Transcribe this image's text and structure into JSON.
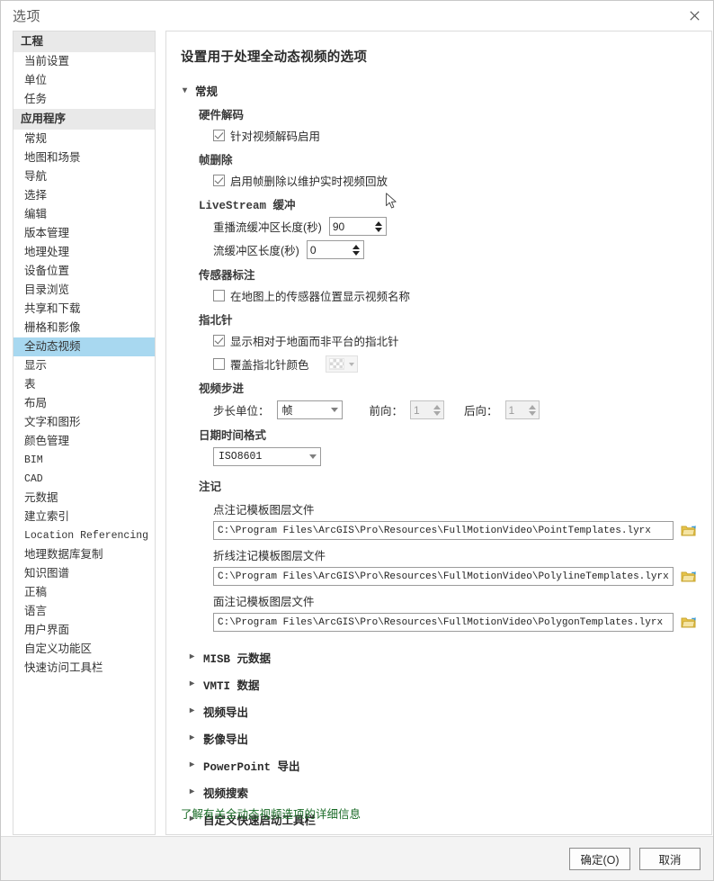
{
  "window": {
    "title": "选项",
    "close_icon": "close-icon"
  },
  "sidebar": {
    "groups": [
      {
        "header": "工程",
        "items": [
          {
            "label": "当前设置",
            "selected": false,
            "mono": false
          },
          {
            "label": "单位",
            "selected": false,
            "mono": false
          },
          {
            "label": "任务",
            "selected": false,
            "mono": false
          }
        ]
      },
      {
        "header": "应用程序",
        "items": [
          {
            "label": "常规",
            "selected": false,
            "mono": false
          },
          {
            "label": "地图和场景",
            "selected": false,
            "mono": false
          },
          {
            "label": "导航",
            "selected": false,
            "mono": false
          },
          {
            "label": "选择",
            "selected": false,
            "mono": false
          },
          {
            "label": "编辑",
            "selected": false,
            "mono": false
          },
          {
            "label": "版本管理",
            "selected": false,
            "mono": false
          },
          {
            "label": "地理处理",
            "selected": false,
            "mono": false
          },
          {
            "label": "设备位置",
            "selected": false,
            "mono": false
          },
          {
            "label": "目录浏览",
            "selected": false,
            "mono": false
          },
          {
            "label": "共享和下载",
            "selected": false,
            "mono": false
          },
          {
            "label": "栅格和影像",
            "selected": false,
            "mono": false
          },
          {
            "label": "全动态视频",
            "selected": true,
            "mono": false
          },
          {
            "label": "显示",
            "selected": false,
            "mono": false
          },
          {
            "label": "表",
            "selected": false,
            "mono": false
          },
          {
            "label": "布局",
            "selected": false,
            "mono": false
          },
          {
            "label": "文字和图形",
            "selected": false,
            "mono": false
          },
          {
            "label": "颜色管理",
            "selected": false,
            "mono": false
          },
          {
            "label": "BIM",
            "selected": false,
            "mono": true
          },
          {
            "label": "CAD",
            "selected": false,
            "mono": true
          },
          {
            "label": "元数据",
            "selected": false,
            "mono": false
          },
          {
            "label": "建立索引",
            "selected": false,
            "mono": false
          },
          {
            "label": "Location Referencing",
            "selected": false,
            "mono": true
          },
          {
            "label": "地理数据库复制",
            "selected": false,
            "mono": false
          },
          {
            "label": "知识图谱",
            "selected": false,
            "mono": false
          },
          {
            "label": "正稿",
            "selected": false,
            "mono": false
          },
          {
            "label": "语言",
            "selected": false,
            "mono": false
          },
          {
            "label": "用户界面",
            "selected": false,
            "mono": false
          },
          {
            "label": "自定义功能区",
            "selected": false,
            "mono": false
          },
          {
            "label": "快速访问工具栏",
            "selected": false,
            "mono": false
          }
        ]
      }
    ]
  },
  "main": {
    "page_title": "设置用于处理全动态视频的选项",
    "general": {
      "header": "常规",
      "expand_icon": "chevron-down-icon",
      "hardware_decode": {
        "header": "硬件解码",
        "checkbox_label": "针对视频解码启用",
        "checked": true
      },
      "frame_drop": {
        "header": "帧删除",
        "checkbox_label": "启用帧删除以维护实时视频回放",
        "checked": true
      },
      "livestream": {
        "header": "LiveStream 缓冲",
        "replay_label": "重播流缓冲区长度(秒)",
        "replay_value": "90",
        "stream_label": "流缓冲区长度(秒)",
        "stream_value": "0"
      },
      "sensor_annotation": {
        "header": "传感器标注",
        "checkbox_label": "在地图上的传感器位置显示视频名称",
        "checked": false
      },
      "compass": {
        "header": "指北针",
        "ground_label": "显示相对于地面而非平台的指北针",
        "ground_checked": true,
        "override_label": "覆盖指北针颜色",
        "override_checked": false,
        "swatch_name": "transparent-color-swatch"
      },
      "video_step": {
        "header": "视频步进",
        "unit_label": "步长单位：",
        "unit_value": "帧",
        "forward_label": "前向：",
        "forward_value": "1",
        "backward_label": "后向：",
        "backward_value": "1"
      },
      "datetime": {
        "header": "日期时间格式",
        "value": "ISO8601"
      },
      "annotation": {
        "header": "注记",
        "rows": [
          {
            "label": "点注记模板图层文件",
            "path": "C:\\Program Files\\ArcGIS\\Pro\\Resources\\FullMotionVideo\\PointTemplates.lyrx",
            "browse_icon": "open-folder-icon"
          },
          {
            "label": "折线注记模板图层文件",
            "path": "C:\\Program Files\\ArcGIS\\Pro\\Resources\\FullMotionVideo\\PolylineTemplates.lyrx",
            "browse_icon": "open-folder-icon"
          },
          {
            "label": "面注记模板图层文件",
            "path": "C:\\Program Files\\ArcGIS\\Pro\\Resources\\FullMotionVideo\\PolygonTemplates.lyrx",
            "browse_icon": "open-folder-icon"
          }
        ]
      }
    },
    "collapsed_sections": [
      {
        "label": "MISB 元数据",
        "mono": true,
        "icon": "chevron-right-icon"
      },
      {
        "label": "VMTI 数据",
        "mono": true,
        "icon": "chevron-right-icon"
      },
      {
        "label": "视频导出",
        "mono": false,
        "icon": "chevron-right-icon"
      },
      {
        "label": "影像导出",
        "mono": false,
        "icon": "chevron-right-icon"
      },
      {
        "label": "PowerPoint 导出",
        "mono": true,
        "icon": "chevron-right-icon"
      },
      {
        "label": "视频搜索",
        "mono": false,
        "icon": "chevron-right-icon"
      },
      {
        "label": "自定义快速启动工具栏",
        "mono": false,
        "icon": "chevron-right-icon"
      }
    ],
    "help_link": "了解有关全动态视频选项的详细信息"
  },
  "footer": {
    "ok_label": "确定(O)",
    "cancel_label": "取消"
  },
  "colors": {
    "selection": "#a8d8f0",
    "group_header_bg": "#e9e9e9",
    "link": "#1a6b27",
    "folder_icon": "#e8c44a"
  }
}
